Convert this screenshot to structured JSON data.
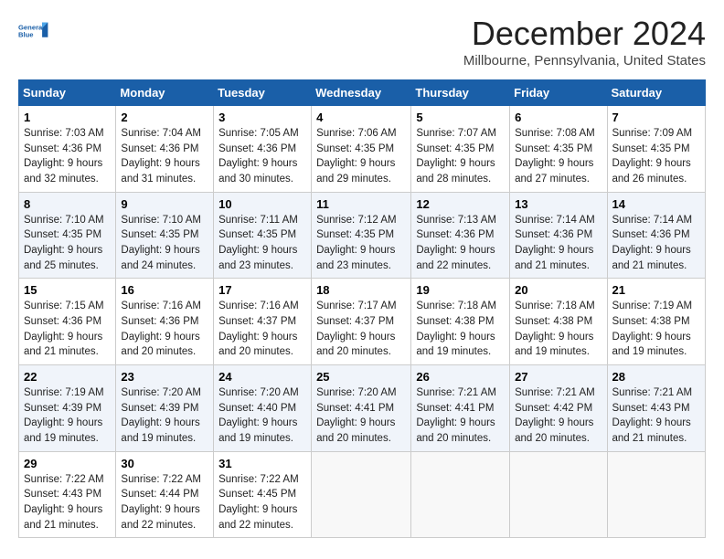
{
  "header": {
    "logo_line1": "General",
    "logo_line2": "Blue",
    "title": "December 2024",
    "subtitle": "Millbourne, Pennsylvania, United States"
  },
  "days_of_week": [
    "Sunday",
    "Monday",
    "Tuesday",
    "Wednesday",
    "Thursday",
    "Friday",
    "Saturday"
  ],
  "weeks": [
    [
      {
        "day": 1,
        "sunrise": "7:03 AM",
        "sunset": "4:36 PM",
        "daylight": "9 hours and 32 minutes."
      },
      {
        "day": 2,
        "sunrise": "7:04 AM",
        "sunset": "4:36 PM",
        "daylight": "9 hours and 31 minutes."
      },
      {
        "day": 3,
        "sunrise": "7:05 AM",
        "sunset": "4:36 PM",
        "daylight": "9 hours and 30 minutes."
      },
      {
        "day": 4,
        "sunrise": "7:06 AM",
        "sunset": "4:35 PM",
        "daylight": "9 hours and 29 minutes."
      },
      {
        "day": 5,
        "sunrise": "7:07 AM",
        "sunset": "4:35 PM",
        "daylight": "9 hours and 28 minutes."
      },
      {
        "day": 6,
        "sunrise": "7:08 AM",
        "sunset": "4:35 PM",
        "daylight": "9 hours and 27 minutes."
      },
      {
        "day": 7,
        "sunrise": "7:09 AM",
        "sunset": "4:35 PM",
        "daylight": "9 hours and 26 minutes."
      }
    ],
    [
      {
        "day": 8,
        "sunrise": "7:10 AM",
        "sunset": "4:35 PM",
        "daylight": "9 hours and 25 minutes."
      },
      {
        "day": 9,
        "sunrise": "7:10 AM",
        "sunset": "4:35 PM",
        "daylight": "9 hours and 24 minutes."
      },
      {
        "day": 10,
        "sunrise": "7:11 AM",
        "sunset": "4:35 PM",
        "daylight": "9 hours and 23 minutes."
      },
      {
        "day": 11,
        "sunrise": "7:12 AM",
        "sunset": "4:35 PM",
        "daylight": "9 hours and 23 minutes."
      },
      {
        "day": 12,
        "sunrise": "7:13 AM",
        "sunset": "4:36 PM",
        "daylight": "9 hours and 22 minutes."
      },
      {
        "day": 13,
        "sunrise": "7:14 AM",
        "sunset": "4:36 PM",
        "daylight": "9 hours and 21 minutes."
      },
      {
        "day": 14,
        "sunrise": "7:14 AM",
        "sunset": "4:36 PM",
        "daylight": "9 hours and 21 minutes."
      }
    ],
    [
      {
        "day": 15,
        "sunrise": "7:15 AM",
        "sunset": "4:36 PM",
        "daylight": "9 hours and 21 minutes."
      },
      {
        "day": 16,
        "sunrise": "7:16 AM",
        "sunset": "4:36 PM",
        "daylight": "9 hours and 20 minutes."
      },
      {
        "day": 17,
        "sunrise": "7:16 AM",
        "sunset": "4:37 PM",
        "daylight": "9 hours and 20 minutes."
      },
      {
        "day": 18,
        "sunrise": "7:17 AM",
        "sunset": "4:37 PM",
        "daylight": "9 hours and 20 minutes."
      },
      {
        "day": 19,
        "sunrise": "7:18 AM",
        "sunset": "4:38 PM",
        "daylight": "9 hours and 19 minutes."
      },
      {
        "day": 20,
        "sunrise": "7:18 AM",
        "sunset": "4:38 PM",
        "daylight": "9 hours and 19 minutes."
      },
      {
        "day": 21,
        "sunrise": "7:19 AM",
        "sunset": "4:38 PM",
        "daylight": "9 hours and 19 minutes."
      }
    ],
    [
      {
        "day": 22,
        "sunrise": "7:19 AM",
        "sunset": "4:39 PM",
        "daylight": "9 hours and 19 minutes."
      },
      {
        "day": 23,
        "sunrise": "7:20 AM",
        "sunset": "4:39 PM",
        "daylight": "9 hours and 19 minutes."
      },
      {
        "day": 24,
        "sunrise": "7:20 AM",
        "sunset": "4:40 PM",
        "daylight": "9 hours and 19 minutes."
      },
      {
        "day": 25,
        "sunrise": "7:20 AM",
        "sunset": "4:41 PM",
        "daylight": "9 hours and 20 minutes."
      },
      {
        "day": 26,
        "sunrise": "7:21 AM",
        "sunset": "4:41 PM",
        "daylight": "9 hours and 20 minutes."
      },
      {
        "day": 27,
        "sunrise": "7:21 AM",
        "sunset": "4:42 PM",
        "daylight": "9 hours and 20 minutes."
      },
      {
        "day": 28,
        "sunrise": "7:21 AM",
        "sunset": "4:43 PM",
        "daylight": "9 hours and 21 minutes."
      }
    ],
    [
      {
        "day": 29,
        "sunrise": "7:22 AM",
        "sunset": "4:43 PM",
        "daylight": "9 hours and 21 minutes."
      },
      {
        "day": 30,
        "sunrise": "7:22 AM",
        "sunset": "4:44 PM",
        "daylight": "9 hours and 22 minutes."
      },
      {
        "day": 31,
        "sunrise": "7:22 AM",
        "sunset": "4:45 PM",
        "daylight": "9 hours and 22 minutes."
      },
      null,
      null,
      null,
      null
    ]
  ]
}
